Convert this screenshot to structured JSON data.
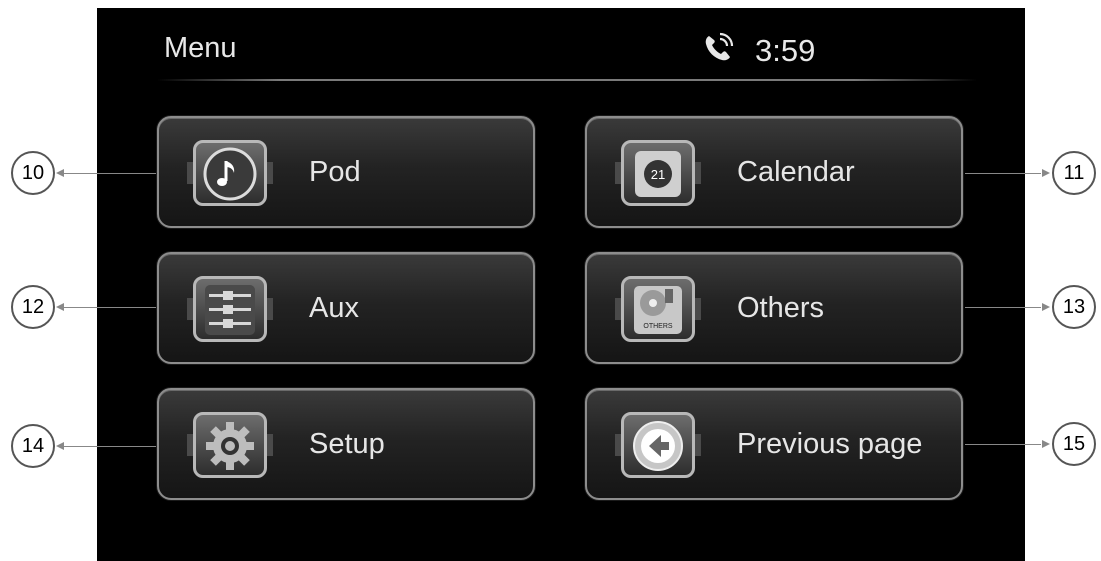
{
  "header": {
    "title": "Menu",
    "time": "3:59",
    "phone_icon": "phone-call-icon"
  },
  "menu": {
    "pod": {
      "label": "Pod",
      "icon": "music-note-icon",
      "callout": "10"
    },
    "calendar": {
      "label": "Calendar",
      "icon": "calendar-icon",
      "day": "21",
      "callout": "11"
    },
    "aux": {
      "label": "Aux",
      "icon": "audio-jack-icon",
      "callout": "12"
    },
    "others": {
      "label": "Others",
      "icon": "others-icon",
      "icon_text": "OTHERS",
      "callout": "13"
    },
    "setup": {
      "label": "Setup",
      "icon": "gear-icon",
      "callout": "14"
    },
    "previous": {
      "label": "Previous page",
      "icon": "back-arrow-icon",
      "callout": "15"
    }
  },
  "colors": {
    "screen_bg": "#000000",
    "text": "#e6e6e6",
    "border": "#8d8d8d"
  }
}
